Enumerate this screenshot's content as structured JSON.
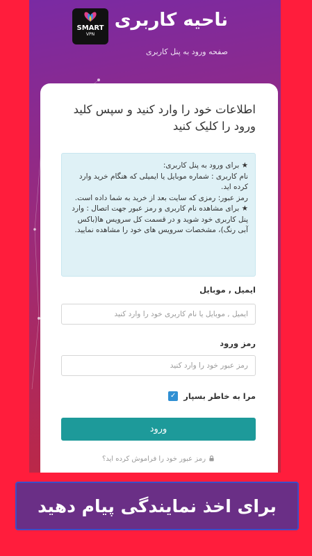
{
  "header": {
    "logo": {
      "brand": "SMART",
      "sub": "VPN"
    },
    "title": "ناحیه کاربری",
    "subtitle": "صفحه ورود به پنل کاربری"
  },
  "card": {
    "title": "اطلاعات خود را وارد کنید و سپس کلید ورود را کلیک کنید",
    "info": [
      "★ برای ورود به پنل کاربری:",
      "نام کاربری : شماره موبایل یا ایمیلی که هنگام خرید وارد کرده اید.",
      "رمز عبور: رمزی که سایت بعد از خرید به شما داده است.",
      "★ برای مشاهده نام کاربری و رمز عبور جهت اتصال : وارد پنل کاربری خود شوید و در قسمت کل سرویس ها(باکس آبی رنگ)، مشخصات سرویس های خود را مشاهده نمایید."
    ],
    "username_label": "ایمیل , موبایل",
    "username_placeholder": "ایمیل , موبایل یا نام کاربری خود را وارد کنید",
    "password_label": "رمز ورود",
    "password_placeholder": "رمز عبور خود را وارد کنید",
    "remember_label": "مرا به خاطر بسپار",
    "remember_checked": true,
    "login_button": "ورود",
    "forgot_link": "رمز عبور خود را فراموش کرده اید؟"
  },
  "banner": {
    "text": "برای اخذ نمایندگی پیام دهید"
  },
  "colors": {
    "outer_background": "#ff1d3c",
    "header_gradient": [
      "#7a2aa3",
      "#c0283f"
    ],
    "info_box": "#dff1f6",
    "button": "#1d9a9a",
    "checkbox": "#2f8fd3",
    "banner_fill": "#6a2f86",
    "banner_border": "#3b4dc7"
  },
  "icons": [
    "logo-icon",
    "lock-icon",
    "check-icon"
  ]
}
